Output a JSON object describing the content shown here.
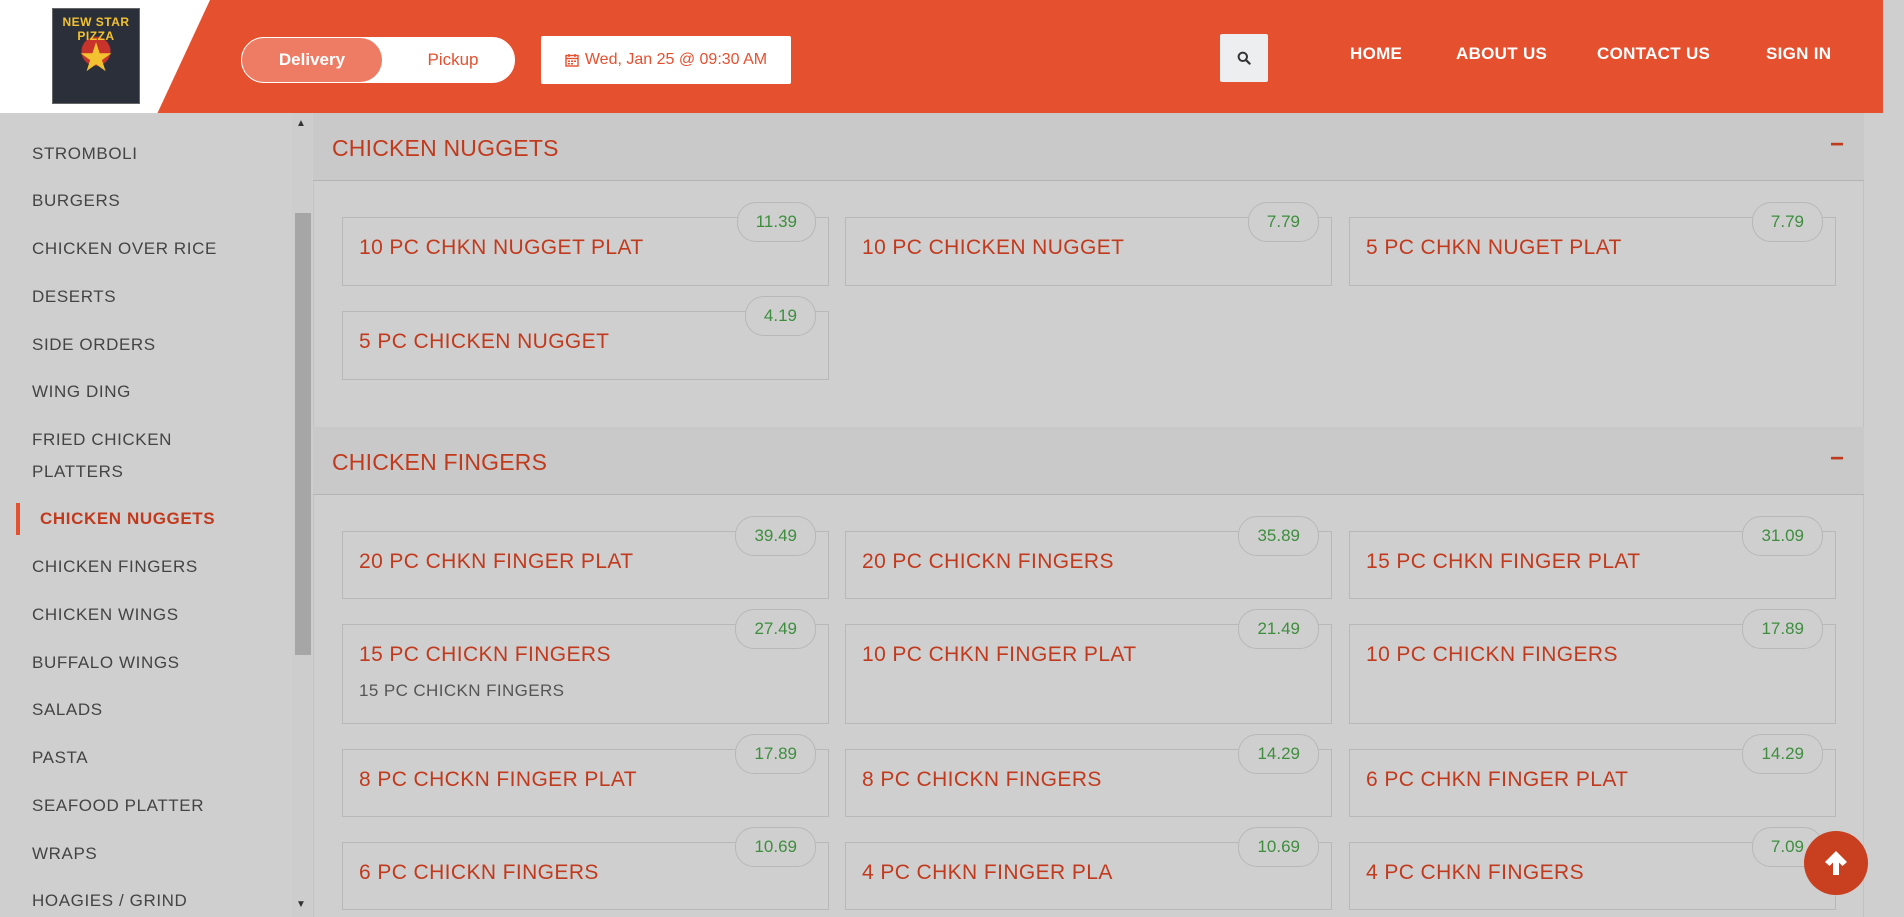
{
  "header": {
    "logo_text": "NEW STAR PIZZA",
    "order_mode": {
      "active": "Delivery",
      "inactive": "Pickup"
    },
    "datetime": "Wed, Jan 25 @ 09:30 AM",
    "nav": [
      "HOME",
      "ABOUT US",
      "CONTACT US",
      "SIGN IN"
    ]
  },
  "sidebar": {
    "items": [
      "STROMBOLI",
      "BURGERS",
      "CHICKEN OVER RICE",
      "DESERTS",
      "SIDE ORDERS",
      "WING DING",
      "FRIED CHICKEN",
      "PLATTERS",
      "CHICKEN NUGGETS",
      "CHICKEN FINGERS",
      "CHICKEN WINGS",
      "BUFFALO WINGS",
      "SALADS",
      "PASTA",
      "SEAFOOD PLATTER",
      "WRAPS",
      "HOAGIES / GRIND"
    ],
    "active": "CHICKEN NUGGETS"
  },
  "sections": [
    {
      "title": "CHICKEN NUGGETS",
      "collapse": "−",
      "items": [
        {
          "name": "10 PC CHKN NUGGET PLAT",
          "price": "11.39"
        },
        {
          "name": "10 PC CHICKEN NUGGET",
          "price": "7.79"
        },
        {
          "name": "5 PC CHKN NUGET PLAT",
          "price": "7.79"
        },
        {
          "name": "5 PC CHICKEN NUGGET",
          "price": "4.19"
        }
      ]
    },
    {
      "title": "CHICKEN FINGERS",
      "collapse": "−",
      "items": [
        {
          "name": "20 PC CHKN FINGER PLAT",
          "price": "39.49"
        },
        {
          "name": "20 PC CHICKN FINGERS",
          "price": "35.89"
        },
        {
          "name": "15 PC CHKN FINGER PLAT",
          "price": "31.09"
        },
        {
          "name": "15 PC CHICKN FINGERS",
          "price": "27.49",
          "desc": "15 PC CHICKN FINGERS"
        },
        {
          "name": "10 PC CHKN FINGER PLAT",
          "price": "21.49"
        },
        {
          "name": "10 PC CHICKN FINGERS",
          "price": "17.89"
        },
        {
          "name": "8 PC CHCKN FINGER PLAT",
          "price": "17.89"
        },
        {
          "name": "8 PC CHICKN FINGERS",
          "price": "14.29"
        },
        {
          "name": "6 PC CHKN FINGER PLAT",
          "price": "14.29"
        },
        {
          "name": "6 PC CHICKN FINGERS",
          "price": "10.69"
        },
        {
          "name": "4 PC CHKN FINGER PLA",
          "price": "10.69"
        },
        {
          "name": "4 PC CHKN FINGERS",
          "price": "7.09"
        }
      ]
    }
  ],
  "colors": {
    "brand": "#e5502f",
    "price": "#3e8e3e",
    "title": "#c23a1d"
  },
  "icons": [
    "calendar-icon",
    "search-icon",
    "arrow-up-icon",
    "minus-icon"
  ]
}
